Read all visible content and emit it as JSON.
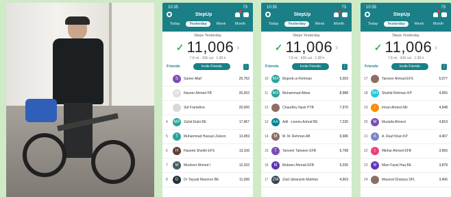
{
  "photo": {
    "alt": "man with folding bicycle"
  },
  "colors": {
    "accent": "#1a7f86",
    "check": "#39b34a"
  },
  "phones": [
    {
      "status": {
        "time": "10:35",
        "battery": "73"
      },
      "title": "StepUp",
      "tabs": [
        "Today",
        "Yesterday",
        "Week",
        "Month"
      ],
      "active_tab": 1,
      "steps_label": "Steps Yesterday",
      "steps": "11,006",
      "stats": "7.8 mi · 436 cal · 1:38 h",
      "friends_label": "Friends",
      "invite_label": "Invite Friends",
      "rows": [
        {
          "rank": "",
          "initial": "S",
          "color": "#7b4bb8",
          "name": "Samer Altaf",
          "value": "25,762"
        },
        {
          "rank": "",
          "initial": "N",
          "color": "#e0e0e0",
          "name": "Naseer Ahmed FB",
          "value": "20,302"
        },
        {
          "rank": "",
          "initial": "",
          "color": "#d8d8d8",
          "name": "Sid Frameline",
          "value": "20,006"
        },
        {
          "rank": "4",
          "initial": "MP",
          "color": "#26a69a",
          "name": "Zahid Elahi BE",
          "value": "17,457"
        },
        {
          "rank": "5",
          "initial": "T",
          "color": "#26a69a",
          "name": "Muhammad Hassan Zatoon",
          "value": "13,459"
        },
        {
          "rank": "6",
          "initial": "H",
          "color": "#5d4037",
          "name": "Haseeb Sheikh EFS",
          "value": "13,106"
        },
        {
          "rank": "7",
          "initial": "M",
          "color": "#455a64",
          "name": "Musheer Ahmed I",
          "value": "12,332"
        },
        {
          "rank": "8",
          "initial": "D",
          "color": "#263238",
          "name": "Dr Tayyab Mansoor BE",
          "value": "11,006"
        }
      ]
    },
    {
      "status": {
        "time": "10:35",
        "battery": "73"
      },
      "title": "StepUp",
      "tabs": [
        "Today",
        "Yesterday",
        "Week",
        "Month"
      ],
      "active_tab": 1,
      "steps_label": "Steps Yesterday",
      "steps": "11,006",
      "stats": "7.8 mi · 436 cal · 1:38 h",
      "friends_label": "Friends",
      "invite_label": "Invite Friends",
      "rows": [
        {
          "rank": "10",
          "initial": "MA",
          "color": "#26a69a",
          "name": "Mujeeb-ur-Rehman",
          "value": "9,303"
        },
        {
          "rank": "11",
          "initial": "MA",
          "color": "#26a69a",
          "name": "Muhammad Akbar",
          "value": "8,988"
        },
        {
          "rank": "12",
          "initial": "",
          "color": "#8d6e63",
          "name": "Chaudhry Nasir PTB",
          "value": "7,970"
        },
        {
          "rank": "13",
          "initial": "AA",
          "color": "#00838f",
          "name": "Adil - Leemu Ashraf BE",
          "value": "7,230"
        },
        {
          "rank": "14",
          "initial": "M",
          "color": "#8d6e63",
          "name": "M. M. Rehman AB",
          "value": "6,686"
        },
        {
          "rank": "15",
          "initial": "T",
          "color": "#7b4bb8",
          "name": "Tanveer Tahseen EFB",
          "value": "5,798"
        },
        {
          "rank": "16",
          "initial": "M",
          "color": "#5e35b1",
          "name": "Mubeen Ahmad EFB",
          "value": "5,035"
        },
        {
          "rank": "17",
          "initial": "ZM",
          "color": "#37474f",
          "name": "Zaid Jahanzeb Mukhtar",
          "value": "4,963"
        }
      ]
    },
    {
      "status": {
        "time": "10:35",
        "battery": "73"
      },
      "title": "StepUp",
      "tabs": [
        "Today",
        "Yesterday",
        "Week",
        "Month"
      ],
      "active_tab": 1,
      "steps_label": "Steps Yesterday",
      "steps": "11,006",
      "stats": "7.8 mi · 436 cal · 1:38 h",
      "friends_label": "Friends",
      "invite_label": "Invite Friends",
      "rows": [
        {
          "rank": "17",
          "initial": "",
          "color": "#8d6e63",
          "name": "Tanveer Ahmad EFS",
          "value": "5,077"
        },
        {
          "rank": "18",
          "initial": "SH",
          "color": "#26c6da",
          "name": "Shahid Rehman KP",
          "value": "4,955"
        },
        {
          "rank": "19",
          "initial": "I",
          "color": "#fb8c00",
          "name": "Imran Ahmed Mir",
          "value": "4,948"
        },
        {
          "rank": "20",
          "initial": "M",
          "color": "#7b4bb8",
          "name": "Mustafa Ahmed",
          "value": "4,819"
        },
        {
          "rank": "21",
          "initial": "A",
          "color": "#7986cb",
          "name": "A. Rauf Khan KP",
          "value": "4,407"
        },
        {
          "rank": "22",
          "initial": "I",
          "color": "#ec407a",
          "name": "Iftikhar Ahmed EFB",
          "value": "3,956"
        },
        {
          "rank": "23",
          "initial": "M",
          "color": "#5e35b1",
          "name": "Mian Fazal Haq BE",
          "value": "3,878"
        },
        {
          "rank": "24",
          "initial": "",
          "color": "#8d6e63",
          "name": "Masood Ghaniya SPL",
          "value": "3,406"
        }
      ]
    }
  ]
}
